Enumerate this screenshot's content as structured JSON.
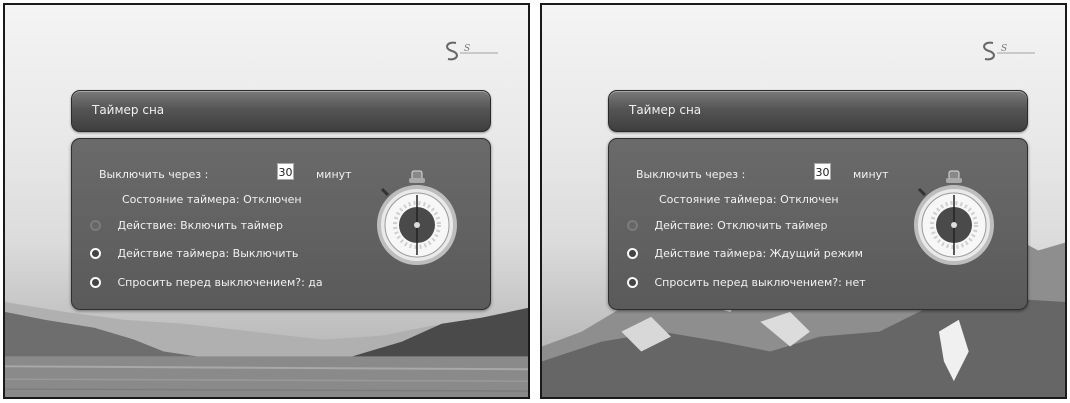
{
  "screens": [
    {
      "header": {
        "title": "Таймер сна"
      },
      "time": {
        "label": "Выключить через :",
        "value": "30",
        "unit": "минут"
      },
      "state": {
        "label": "Состояние таймера:",
        "value": "Отключен"
      },
      "options": [
        {
          "label": "Действие: Включить таймер",
          "enabled": false
        },
        {
          "label": "Действие таймера: Выключить",
          "enabled": true
        },
        {
          "label": "Спросить перед выключением?: да",
          "enabled": true
        }
      ]
    },
    {
      "header": {
        "title": "Таймер сна"
      },
      "time": {
        "label": "Выключить через :",
        "value": "30",
        "unit": "минут"
      },
      "state": {
        "label": "Состояние таймера:",
        "value": "Отключен"
      },
      "options": [
        {
          "label": "Действие: Отключить таймер",
          "enabled": false
        },
        {
          "label": "Действие таймера: Ждущий режим",
          "enabled": true
        },
        {
          "label": "Спросить перед выключением?: нет",
          "enabled": true
        }
      ]
    }
  ],
  "icons": {
    "logo": "s-logo",
    "timer": "stopwatch-icon"
  }
}
